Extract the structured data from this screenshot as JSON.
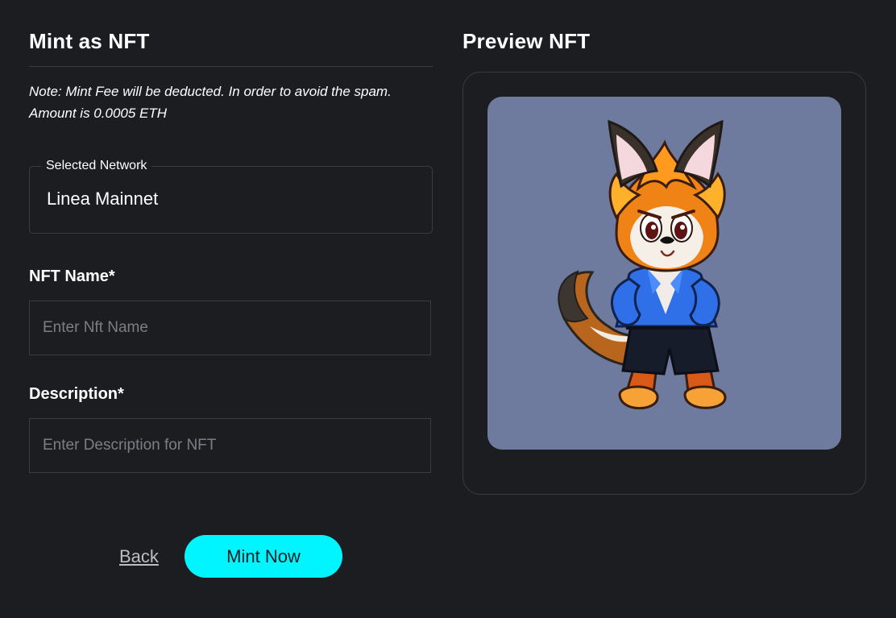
{
  "mint_form": {
    "title": "Mint as NFT",
    "note": "Note: Mint Fee will be deducted. In order to avoid the spam. Amount is 0.0005 ETH",
    "network": {
      "label": "Selected Network",
      "value": "Linea Mainnet"
    },
    "nft_name": {
      "label": "NFT Name*",
      "value": "",
      "placeholder": "Enter Nft Name"
    },
    "description": {
      "label": "Description*",
      "value": "",
      "placeholder": "Enter Description for NFT"
    },
    "actions": {
      "back_label": "Back",
      "mint_label": "Mint Now"
    }
  },
  "preview": {
    "title": "Preview NFT",
    "image": "fox-character-illustration"
  },
  "colors": {
    "background": "#1c1d21",
    "accent": "#00f5ff",
    "border": "#3b3c42",
    "preview_background": "#6e7b9e"
  }
}
